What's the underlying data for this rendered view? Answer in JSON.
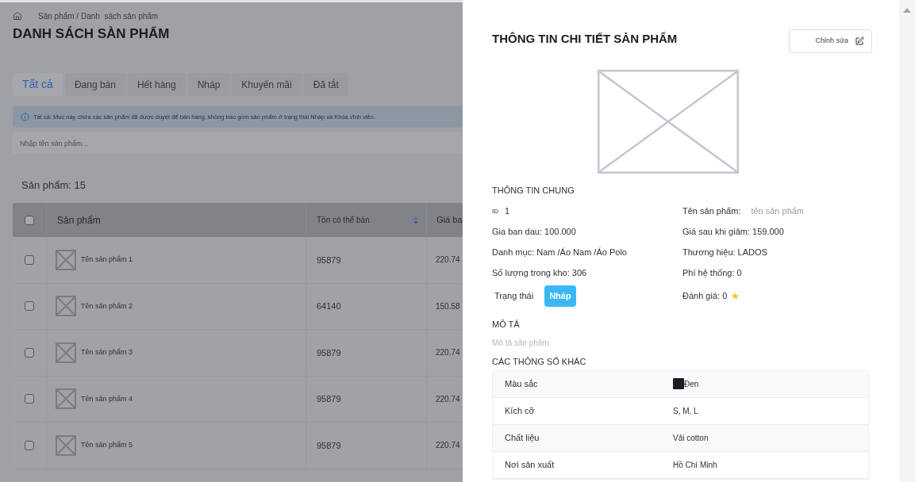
{
  "breadcrumb": "Sản phẩm / Danh  sách sản phẩm",
  "page_title": "DANH SÁCH SÀN PHẨM",
  "tabs": [
    {
      "label": "Tất cả",
      "selected": true
    },
    {
      "label": "Đang bán",
      "selected": false
    },
    {
      "label": "Hết hàng",
      "selected": false
    },
    {
      "label": "Nháp",
      "selected": false
    },
    {
      "label": "Khuyến mãi",
      "selected": false
    },
    {
      "label": "Đã tắt",
      "selected": false
    }
  ],
  "info_notice": "Tất cả: Mục này chứa các sản phẩm đã được duyệt để bán hàng, không bao gồm sản phẩm ở trạng thái Nháp và Khóa vĩnh viễn.",
  "search": {
    "placeholder": "Nhập tên sản phẩm..."
  },
  "product_count": "Sản phẩm: 15",
  "table": {
    "columns": [
      "Sản phẩm",
      "Tồn có thể bán",
      "Giá ba"
    ],
    "select_all_checked": false,
    "rows": [
      {
        "name": "Tên sản phẩm 1",
        "stock": "95879",
        "price": "220.74",
        "checked": false
      },
      {
        "name": "Tên sản phẩm 2",
        "stock": "64140",
        "price": "150.58",
        "checked": false
      },
      {
        "name": "Tên sản phẩm 3",
        "stock": "95879",
        "price": "220.74",
        "checked": false
      },
      {
        "name": "Tên sản phẩm 4",
        "stock": "95879",
        "price": "220.74",
        "checked": false
      },
      {
        "name": "Tên sản phẩm 5",
        "stock": "95879",
        "price": "220.74",
        "checked": false
      }
    ]
  },
  "drawer": {
    "title": "THÔNG TIN CHI TIẾT SẢN PHẨM",
    "edit_button": "Chỉnh sửa",
    "general_heading": "THÔNG TIN CHUNG",
    "id_label": "ID",
    "id_value": "1",
    "name_label": "Tên sản phẩm:",
    "name_value": "tên sản phẩm",
    "fields_left": [
      "Gia ban dau: 100.000",
      "Danh mục: Nam /Áo Nam /Áo Polo",
      "Số lượng trong kho: 306"
    ],
    "fields_right": [
      "Giá sau khi giảm: 159.000",
      "Thương hiệu: LADOS",
      "Phí hệ thống: 0"
    ],
    "status_label": "Trạng thái",
    "status_badge": "Nháp",
    "rating": "Đánh giá: 0",
    "description_heading": "MÔ TẢ",
    "description": "Mô tả sản phẩm",
    "specs_heading": "CÁC THÔNG SỐ KHÁC",
    "specs": [
      {
        "label": "Màu sắc",
        "value": "Đen",
        "color": "#1a1d21"
      },
      {
        "label": "Kích cỡ",
        "value": "S, M, L"
      },
      {
        "label": "Chất liệu",
        "value": "Vải cotton"
      },
      {
        "label": "Nơi sản xuất",
        "value": "Hồ Chí Minh"
      }
    ]
  }
}
